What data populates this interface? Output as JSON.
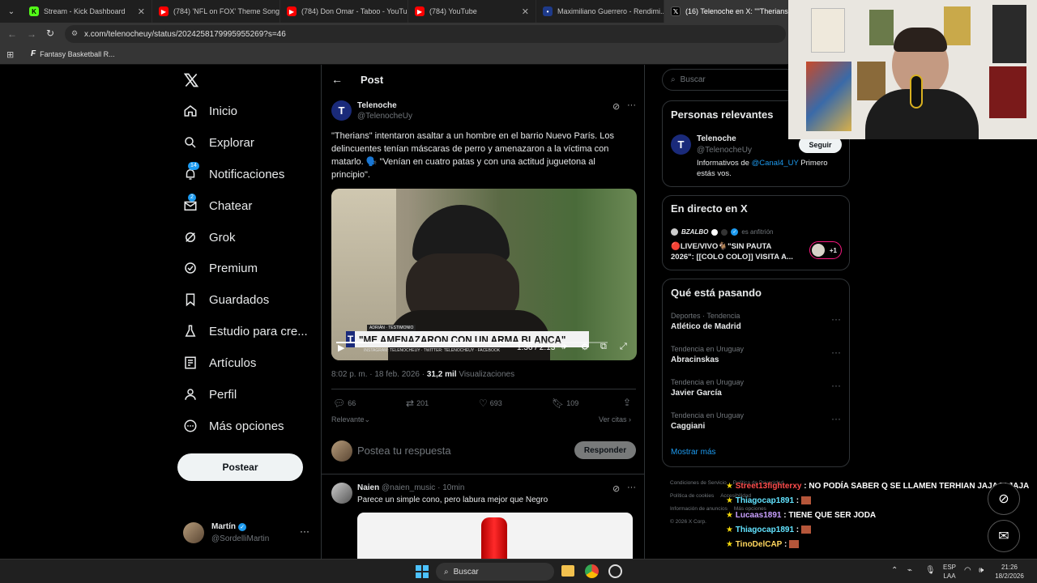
{
  "browser": {
    "tabs": [
      {
        "title": "Stream - Kick Dashboard",
        "icon": "kick-icon",
        "color": "#53fc18"
      },
      {
        "title": "(784) 'NFL on FOX' Theme Song",
        "icon": "youtube-icon",
        "color": "#ff0000"
      },
      {
        "title": "(784) Don Omar - Taboo - YouTube",
        "icon": "youtube-icon",
        "color": "#ff0000"
      },
      {
        "title": "(784) YouTube",
        "icon": "youtube-icon",
        "color": "#ff0000"
      },
      {
        "title": "Maximiliano Guerrero - Rendimi...",
        "icon": "site-icon",
        "color": "#1e3a8a"
      },
      {
        "title": "(16) Telenoche en X: \"\"Therians...",
        "icon": "x-icon",
        "color": "#000000"
      }
    ],
    "url": "x.com/telenocheuy/status/2024258179995955269?s=46",
    "bookmark": "Fantasy Basketball R..."
  },
  "nav": {
    "items": [
      {
        "label": "Inicio",
        "icon": "home-icon"
      },
      {
        "label": "Explorar",
        "icon": "search-icon"
      },
      {
        "label": "Notificaciones",
        "icon": "bell-icon",
        "badge": "14"
      },
      {
        "label": "Chatear",
        "icon": "mail-icon",
        "badge": "2"
      },
      {
        "label": "Grok",
        "icon": "grok-icon"
      },
      {
        "label": "Premium",
        "icon": "verified-icon"
      },
      {
        "label": "Guardados",
        "icon": "bookmark-icon"
      },
      {
        "label": "Estudio para cre...",
        "icon": "flask-icon"
      },
      {
        "label": "Artículos",
        "icon": "article-icon"
      },
      {
        "label": "Perfil",
        "icon": "person-icon"
      },
      {
        "label": "Más opciones",
        "icon": "more-icon"
      }
    ],
    "post_button": "Postear",
    "account": {
      "name": "Martín",
      "handle": "@SordelliMartin"
    }
  },
  "post": {
    "header": "Post",
    "author": "Telenoche",
    "handle": "@TelenocheUy",
    "text": "\"Therians\" intentaron asaltar a un hombre en el barrio Nuevo París. Los delincuentes tenían máscaras de perro y amenazaron a la víctima con matarlo. 🗣️ \"Venían en cuatro patas y con una actitud juguetona al principio\".",
    "video": {
      "lower_third_small": "ADRIÁN · TESTIMONIO",
      "headline": "\"ME AMENAZARON CON UN ARMA BLANCA\"",
      "ticker": "INSTAGRAM: TELENOCHEUY · TWITTER: TELENOCHEUY · FACEBOOK",
      "time": "1:36 / 2:13",
      "progress": 0.73
    },
    "timestamp": "8:02 p. m. · 18 feb. 2026 ·",
    "views_count": "31,2 mil",
    "views_label": "Visualizaciones",
    "stats": {
      "replies": "66",
      "reposts": "201",
      "likes": "693",
      "bookmarks": "109"
    },
    "sort": "Relevante",
    "quotes": "Ver citas",
    "reply_placeholder": "Postea tu respuesta",
    "reply_button": "Responder"
  },
  "reply": {
    "author": "Naien",
    "handle": "@naien_music",
    "time": "· 10min",
    "text": "Parece un simple cono, pero labura mejor que Negro"
  },
  "sidebar": {
    "search_placeholder": "Buscar",
    "relevant": {
      "title": "Personas relevantes",
      "name": "Telenoche",
      "handle": "@TelenocheUy",
      "follow": "Seguir",
      "bio_prefix": "Informativos de ",
      "bio_link": "@Canal4_UY",
      "bio_suffix": " Primero estás vos."
    },
    "live": {
      "title": "En directo en X",
      "host": "BZALBO",
      "host_suffix": "es anfitrión",
      "line1": "🔴LIVE/VIVO🐐\"SIN PAUTA",
      "line2": "2026\": [[COLO COLO]] VISITA A...",
      "count": "+1"
    },
    "trends": {
      "title": "Qué está pasando",
      "items": [
        {
          "context": "Deportes · Tendencia",
          "name": "Atlético de Madrid"
        },
        {
          "context": "Tendencia en Uruguay",
          "name": "Abracinskas"
        },
        {
          "context": "Tendencia en Uruguay",
          "name": "Javier García"
        },
        {
          "context": "Tendencia en Uruguay",
          "name": "Caggiani"
        }
      ],
      "more": "Mostrar más"
    },
    "footer": [
      "Condiciones de Servicio",
      "Política de Privacidad",
      "Política de cookies",
      "Accesibilidad",
      "Información de anuncios",
      "Más opciones",
      "© 2026 X Corp."
    ]
  },
  "chat": [
    {
      "user": "Street13fighterxy",
      "msg": " : NO PODÍA SABER Q SE LLAMEN TERHIAN JAJAJAJAJA",
      "color": "#ff4d4d"
    },
    {
      "user": "Thiagocap1891",
      "msg": " :",
      "color": "#62e3ff"
    },
    {
      "user": "Lucaas1891",
      "msg": " : TIENE QUE SER JODA",
      "color": "#c9a0ff"
    },
    {
      "user": "Thiagocap1891",
      "msg": " :",
      "color": "#62e3ff"
    },
    {
      "user": "TinoDelCAP",
      "msg": " :",
      "color": "#ffd75e"
    }
  ],
  "taskbar": {
    "search": "Buscar",
    "lang1": "ESP",
    "lang2": "LAA",
    "time": "21:26",
    "date": "18/2/2026"
  }
}
